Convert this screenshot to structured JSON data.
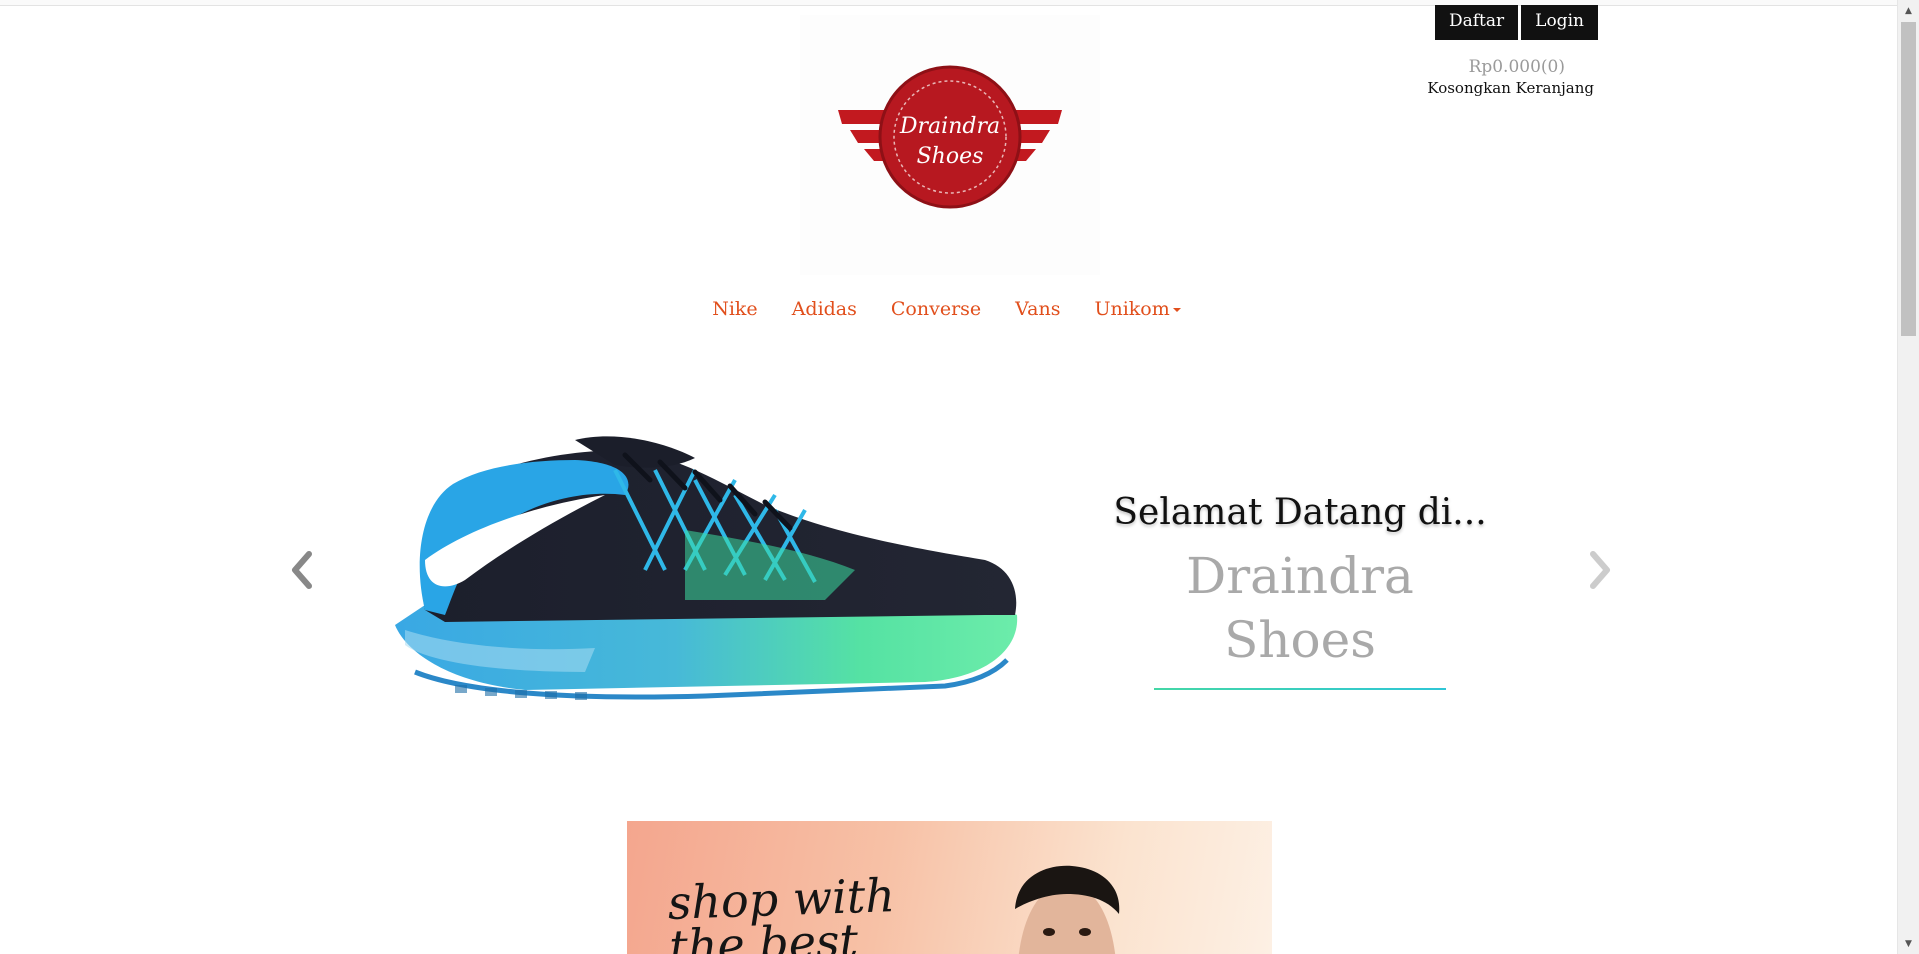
{
  "header": {
    "register_label": "Daftar",
    "login_label": "Login",
    "cart_total": "Rp0.000(0)",
    "cart_empty_label": "Kosongkan Keranjang"
  },
  "logo": {
    "text_line1": "Draindra",
    "text_line2": "Shoes",
    "color": "#c2191f"
  },
  "nav": {
    "items": [
      {
        "label": "Nike"
      },
      {
        "label": "Adidas"
      },
      {
        "label": "Converse"
      },
      {
        "label": "Vans"
      },
      {
        "label": "Unikom",
        "has_dropdown": true
      }
    ],
    "color": "#e14f1c"
  },
  "hero": {
    "welcome": "Selamat Datang di...",
    "brand": "Draindra Shoes",
    "prev_icon": "chevron-left-icon",
    "next_icon": "chevron-right-icon"
  },
  "promo": {
    "text": "shop with the best"
  }
}
